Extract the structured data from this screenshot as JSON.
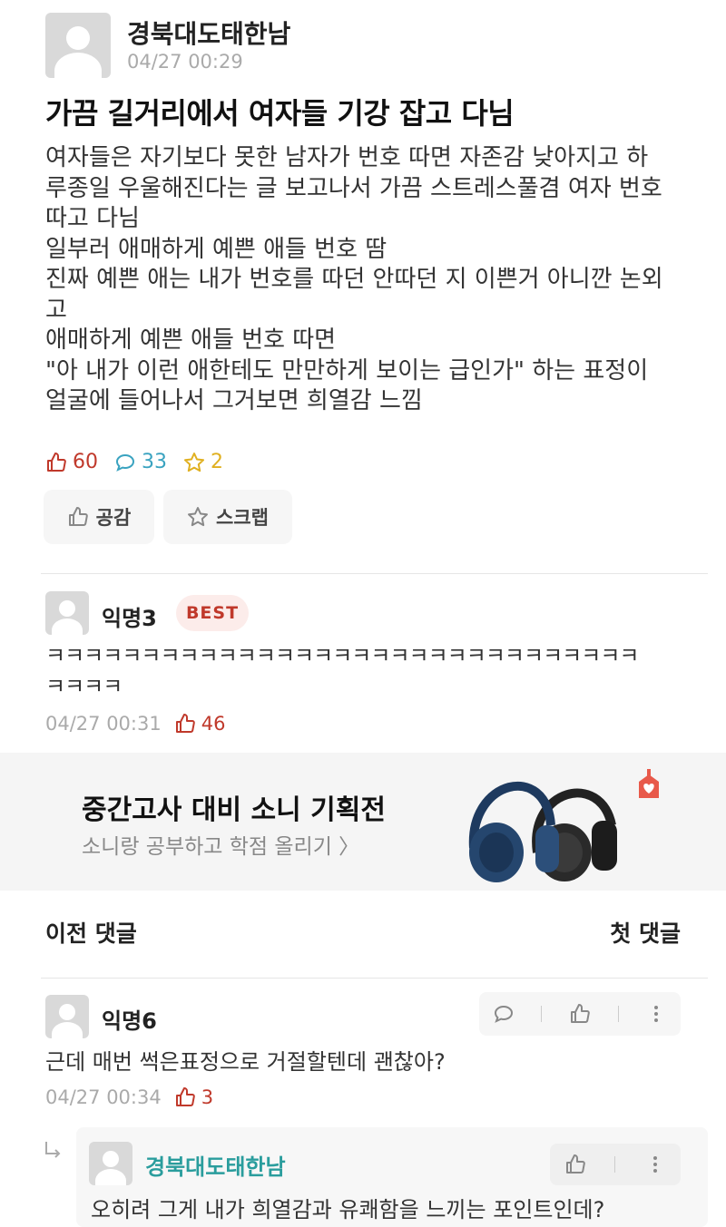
{
  "post": {
    "author": "경북대도태한남",
    "time": "04/27 00:29",
    "title": "가끔 길거리에서 여자들 기강 잡고 다님",
    "body_lines": [
      "여자들은 자기보다 못한 남자가 번호 따면 자존감 낮아지고 하",
      "루종일 우울해진다는 글 보고나서 가끔 스트레스풀겸 여자 번호",
      "따고 다님",
      "일부러 애매하게 예쁜 애들 번호 땀",
      "진짜 예쁜 애는 내가 번호를 따던 안따던 지 이쁜거 아니깐 논외",
      "고",
      "애매하게 예쁜 애들 번호 따면",
      "\"아 내가 이런 애한테도 만만하게 보이는 급인가\" 하는 표정이",
      "얼굴에 들어나서 그거보면 희열감 느낌"
    ],
    "like_count": "60",
    "comment_count": "33",
    "scrap_count": "2",
    "like_button": "공감",
    "scrap_button": "스크랩"
  },
  "best_comment": {
    "author": "익명3",
    "badge": "BEST",
    "text_line1": "ㅋㅋㅋㅋㅋㅋㅋㅋㅋㅋㅋㅋㅋㅋㅋㅋㅋㅋㅋㅋㅋㅋㅋㅋㅋㅋㅋㅋㅋㅋㅋ",
    "text_line2": "ㅋㅋㅋㅋ",
    "time": "04/27 00:31",
    "likes": "46"
  },
  "ad": {
    "title": "중간고사 대비 소니 기획전",
    "subtitle": "소니랑 공부하고 학점 올리기 〉"
  },
  "nav": {
    "prev": "이전 댓글",
    "first": "첫 댓글"
  },
  "comment": {
    "author": "익명6",
    "text": "근데 매번 썩은표정으로 거절할텐데 괜찮아?",
    "time": "04/27 00:34",
    "likes": "3"
  },
  "reply": {
    "author": "경북대도태한남",
    "text": "오히려 그게 내가 희열감과 유쾌함을 느끼는 포인트인데?"
  },
  "colors": {
    "like": "#c0392b",
    "comment": "#3aa3c0",
    "scrap": "#e0b020",
    "author_reply": "#2a9d9d"
  }
}
